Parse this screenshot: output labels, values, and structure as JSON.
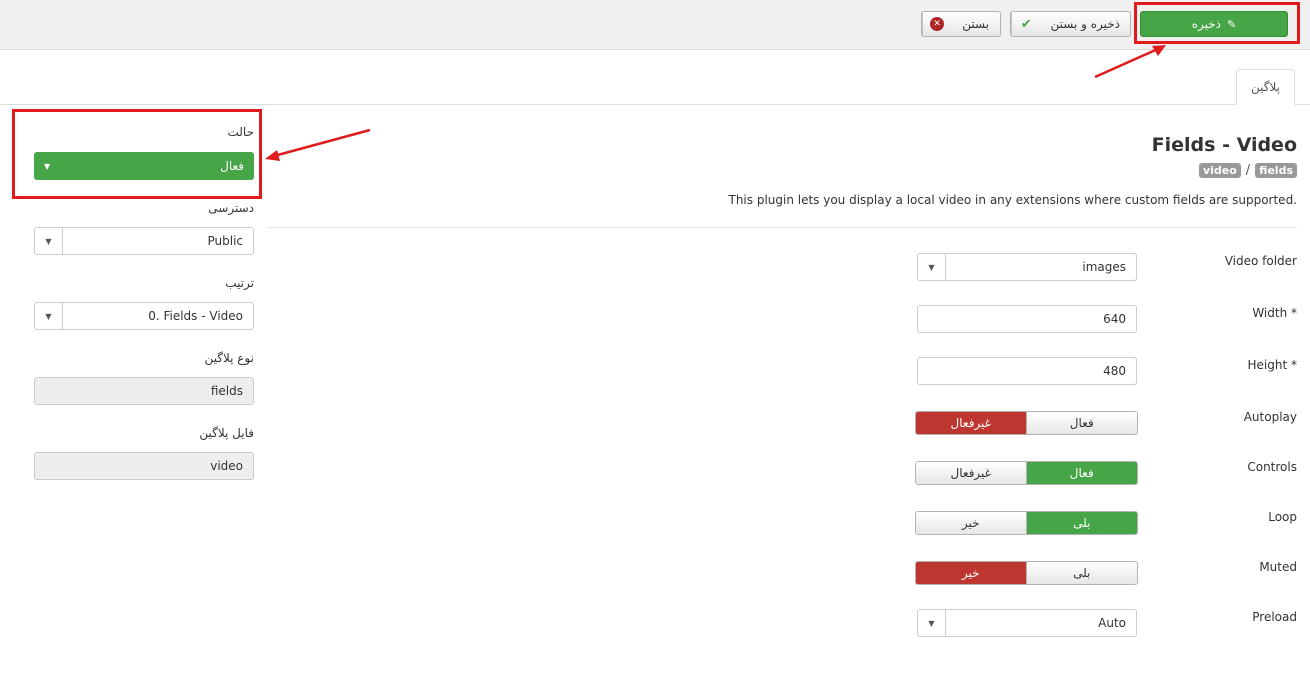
{
  "toolbar": {
    "save_label": "ذخیره",
    "save_icon": "edit-icon",
    "save_close_label": "ذخیره و بستن",
    "save_close_icon": "check-icon",
    "close_label": "بستن",
    "close_icon": "cancel-circle-icon"
  },
  "tabs": [
    {
      "label": "پلاگین"
    }
  ],
  "plugin": {
    "title": "Fields - Video",
    "badge_group": "fields",
    "badge_element": "video",
    "separator": "/",
    "description": "This plugin lets you display a local video in any extensions where custom fields are supported."
  },
  "fields": {
    "video_folder": {
      "label": "Video folder",
      "value": "images"
    },
    "width": {
      "label": "Width *",
      "value": "640"
    },
    "height": {
      "label": "Height *",
      "value": "480"
    },
    "autoplay": {
      "label": "Autoplay",
      "options": [
        "فعال",
        "غیرفعال"
      ],
      "selected": "غیرفعال"
    },
    "controls": {
      "label": "Controls",
      "options": [
        "فعال",
        "غیرفعال"
      ],
      "selected": "فعال"
    },
    "loop": {
      "label": "Loop",
      "options": [
        "بلی",
        "خیر"
      ],
      "selected": "بلی"
    },
    "muted": {
      "label": "Muted",
      "options": [
        "بلی",
        "خیر"
      ],
      "selected": "خیر"
    },
    "preload": {
      "label": "Preload",
      "value": "Auto"
    }
  },
  "sidebar": {
    "status": {
      "label": "حالت",
      "value": "فعال"
    },
    "access": {
      "label": "دسترسی",
      "value": "Public"
    },
    "ordering": {
      "label": "ترتیب",
      "value": "0. Fields - Video"
    },
    "plugin_type": {
      "label": "نوع پلاگین",
      "value": "fields"
    },
    "plugin_file": {
      "label": "فایل پلاگین",
      "value": "video"
    }
  },
  "colors": {
    "success": "#46a546",
    "danger": "#bd362f",
    "annotation": "#e01b1b"
  }
}
